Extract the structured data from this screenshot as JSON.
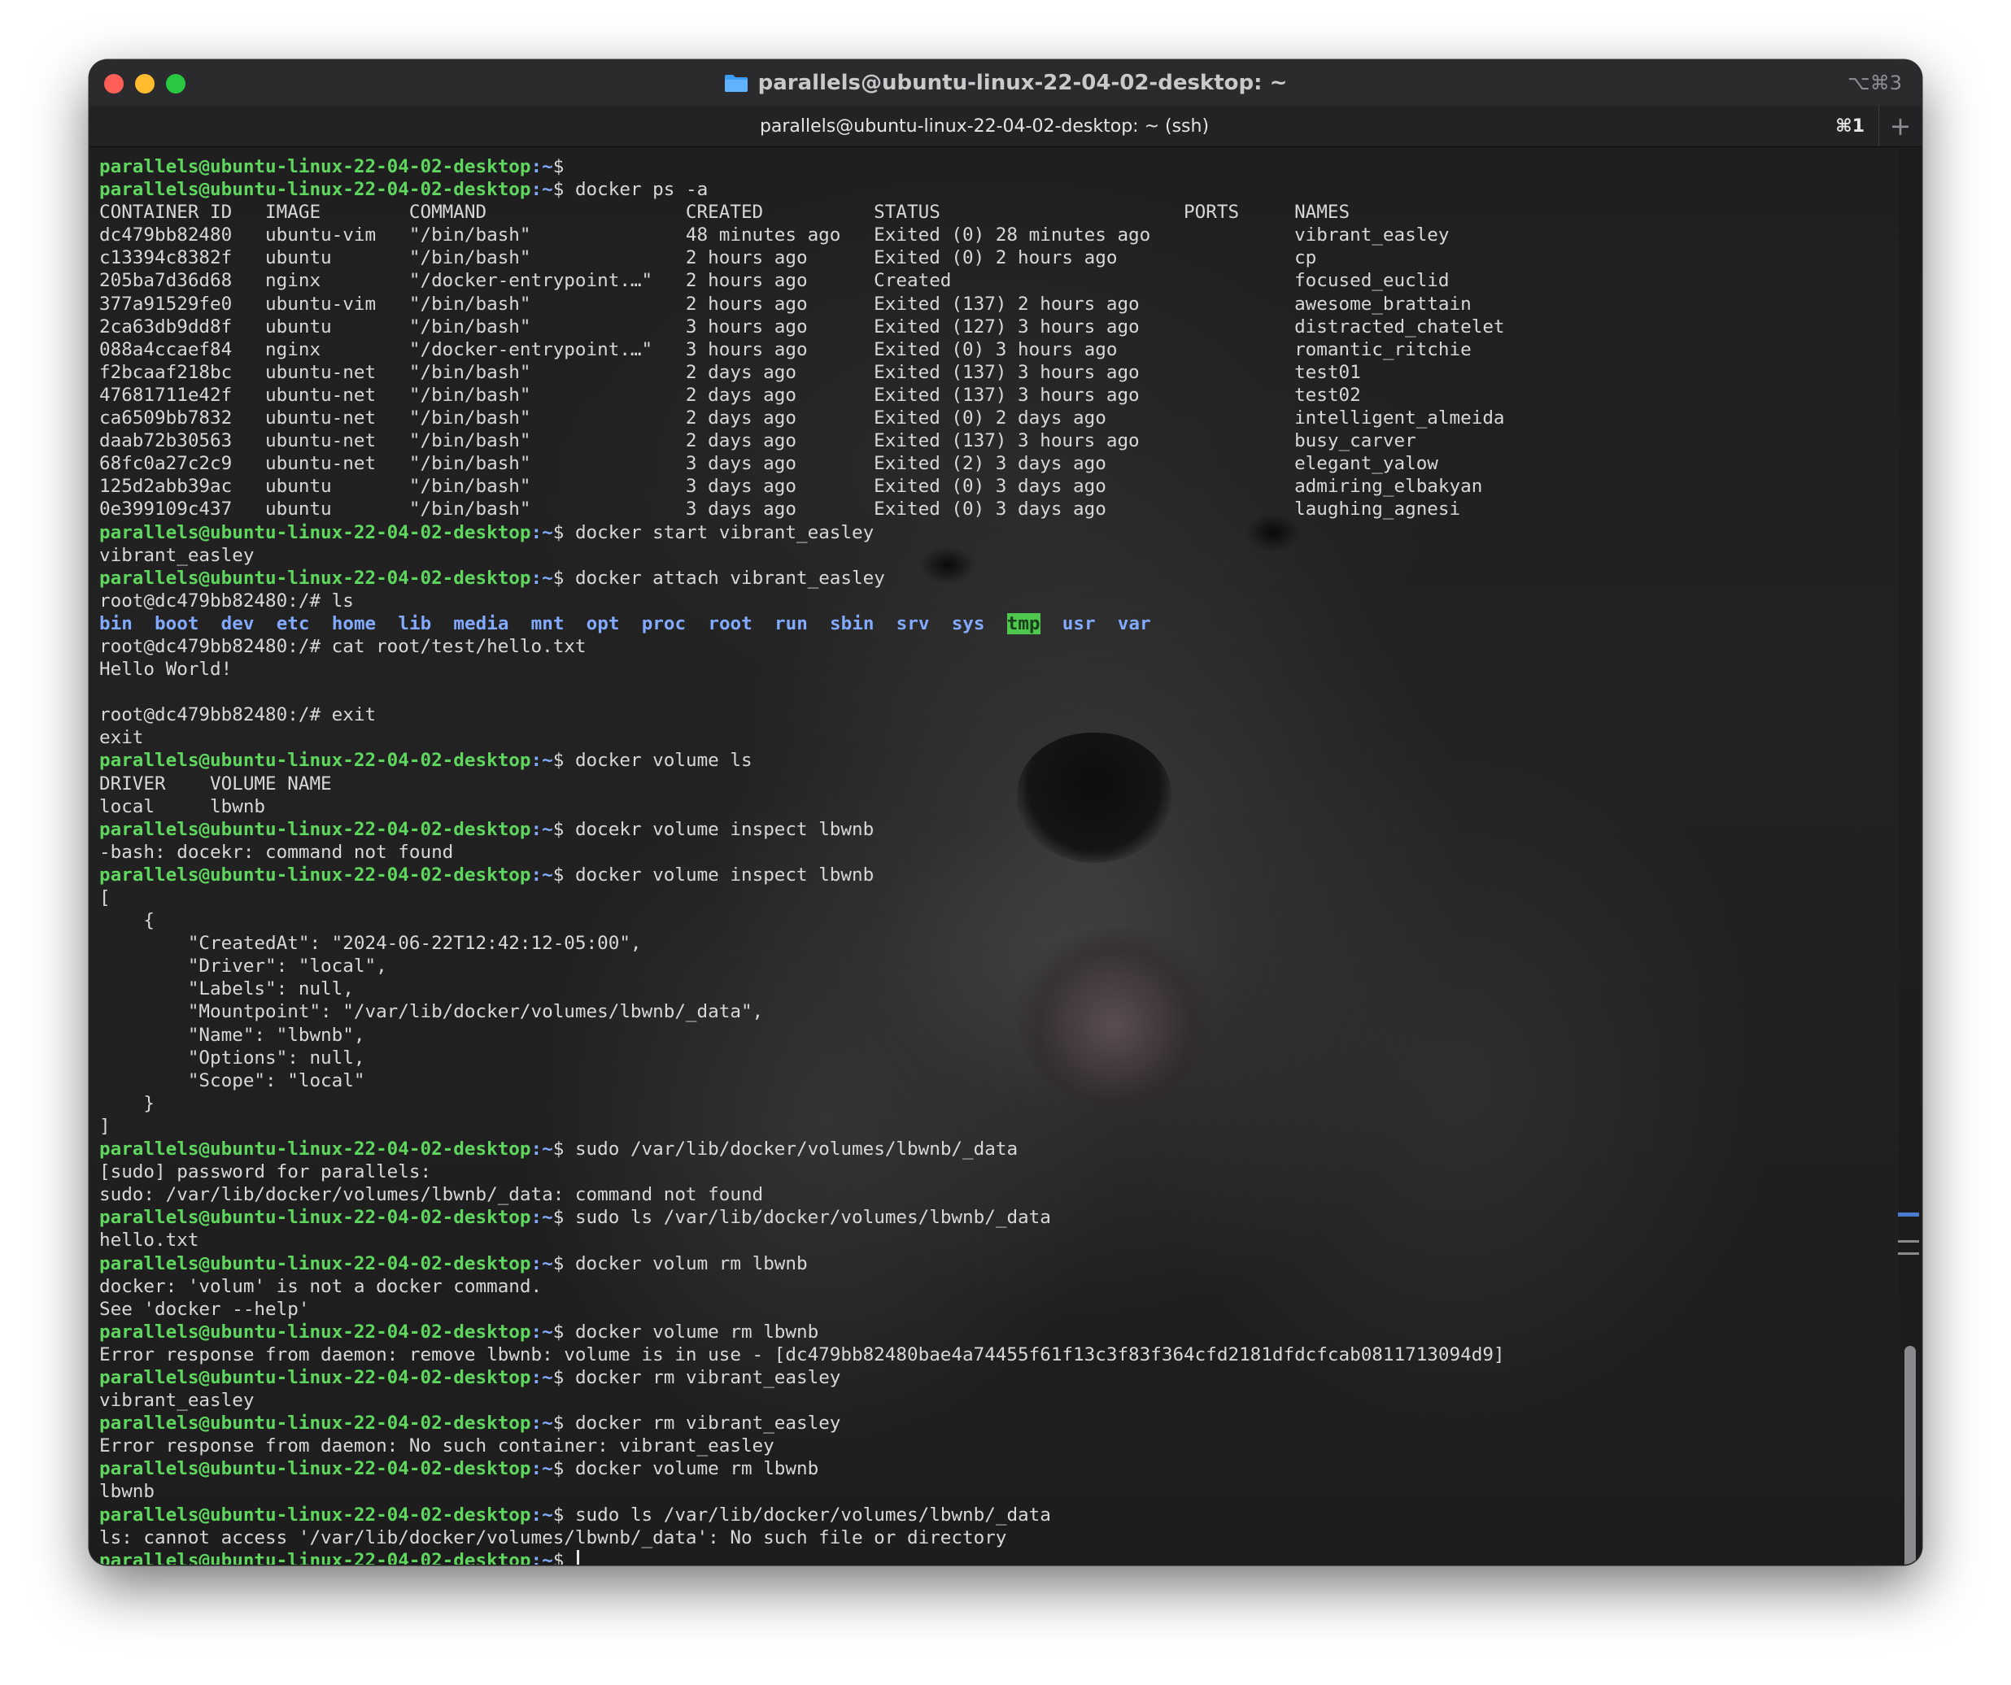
{
  "window": {
    "title": "parallels@ubuntu-linux-22-04-02-desktop: ~",
    "shortcut": "⌥⌘3",
    "tab_label": "parallels@ubuntu-linux-22-04-02-desktop: ~ (ssh)",
    "tab_shortcut": "⌘1",
    "new_tab_symbol": "+"
  },
  "colors": {
    "prompt_user": "#5fd75f",
    "prompt_path": "#82aaff",
    "directory": "#82aaff",
    "tmp_background": "#4ec94e",
    "text": "#d8d8d8"
  },
  "prompt": {
    "user_host": "parallels@ubuntu-linux-22-04-02-desktop",
    "path": ":~",
    "symbol": "$"
  },
  "terminal": {
    "lines": [
      {
        "type": "prompt",
        "cmd": ""
      },
      {
        "type": "prompt",
        "cmd": "docker ps -a"
      },
      {
        "type": "out",
        "text": "CONTAINER ID   IMAGE        COMMAND                  CREATED          STATUS                      PORTS     NAMES"
      },
      {
        "type": "out",
        "text": "dc479bb82480   ubuntu-vim   \"/bin/bash\"              48 minutes ago   Exited (0) 28 minutes ago             vibrant_easley"
      },
      {
        "type": "out",
        "text": "c13394c8382f   ubuntu       \"/bin/bash\"              2 hours ago      Exited (0) 2 hours ago                cp"
      },
      {
        "type": "out",
        "text": "205ba7d36d68   nginx        \"/docker-entrypoint.…\"   2 hours ago      Created                               focused_euclid"
      },
      {
        "type": "out",
        "text": "377a91529fe0   ubuntu-vim   \"/bin/bash\"              2 hours ago      Exited (137) 2 hours ago              awesome_brattain"
      },
      {
        "type": "out",
        "text": "2ca63db9dd8f   ubuntu       \"/bin/bash\"              3 hours ago      Exited (127) 3 hours ago              distracted_chatelet"
      },
      {
        "type": "out",
        "text": "088a4ccaef84   nginx        \"/docker-entrypoint.…\"   3 hours ago      Exited (0) 3 hours ago                romantic_ritchie"
      },
      {
        "type": "out",
        "text": "f2bcaaf218bc   ubuntu-net   \"/bin/bash\"              2 days ago       Exited (137) 3 hours ago              test01"
      },
      {
        "type": "out",
        "text": "47681711e42f   ubuntu-net   \"/bin/bash\"              2 days ago       Exited (137) 3 hours ago              test02"
      },
      {
        "type": "out",
        "text": "ca6509bb7832   ubuntu-net   \"/bin/bash\"              2 days ago       Exited (0) 2 days ago                 intelligent_almeida"
      },
      {
        "type": "out",
        "text": "daab72b30563   ubuntu-net   \"/bin/bash\"              2 days ago       Exited (137) 3 hours ago              busy_carver"
      },
      {
        "type": "out",
        "text": "68fc0a27c2c9   ubuntu-net   \"/bin/bash\"              3 days ago       Exited (2) 3 days ago                 elegant_yalow"
      },
      {
        "type": "out",
        "text": "125d2abb39ac   ubuntu       \"/bin/bash\"              3 days ago       Exited (0) 3 days ago                 admiring_elbakyan"
      },
      {
        "type": "out",
        "text": "0e399109c437   ubuntu       \"/bin/bash\"              3 days ago       Exited (0) 3 days ago                 laughing_agnesi"
      },
      {
        "type": "prompt",
        "cmd": "docker start vibrant_easley"
      },
      {
        "type": "out",
        "text": "vibrant_easley"
      },
      {
        "type": "prompt",
        "cmd": "docker attach vibrant_easley"
      },
      {
        "type": "out",
        "text": "root@dc479bb82480:/# ls"
      },
      {
        "type": "ls",
        "items": [
          "bin",
          "boot",
          "dev",
          "etc",
          "home",
          "lib",
          "media",
          "mnt",
          "opt",
          "proc",
          "root",
          "run",
          "sbin",
          "srv",
          "sys",
          "tmp",
          "usr",
          "var"
        ]
      },
      {
        "type": "out",
        "text": "root@dc479bb82480:/# cat root/test/hello.txt"
      },
      {
        "type": "out",
        "text": "Hello World!"
      },
      {
        "type": "out",
        "text": ""
      },
      {
        "type": "out",
        "text": "root@dc479bb82480:/# exit"
      },
      {
        "type": "out",
        "text": "exit"
      },
      {
        "type": "prompt",
        "cmd": "docker volume ls"
      },
      {
        "type": "out",
        "text": "DRIVER    VOLUME NAME"
      },
      {
        "type": "out",
        "text": "local     lbwnb"
      },
      {
        "type": "prompt",
        "cmd": "docekr volume inspect lbwnb"
      },
      {
        "type": "out",
        "text": "-bash: docekr: command not found"
      },
      {
        "type": "prompt",
        "cmd": "docker volume inspect lbwnb"
      },
      {
        "type": "out",
        "text": "["
      },
      {
        "type": "out",
        "text": "    {"
      },
      {
        "type": "out",
        "text": "        \"CreatedAt\": \"2024-06-22T12:42:12-05:00\","
      },
      {
        "type": "out",
        "text": "        \"Driver\": \"local\","
      },
      {
        "type": "out",
        "text": "        \"Labels\": null,"
      },
      {
        "type": "out",
        "text": "        \"Mountpoint\": \"/var/lib/docker/volumes/lbwnb/_data\","
      },
      {
        "type": "out",
        "text": "        \"Name\": \"lbwnb\","
      },
      {
        "type": "out",
        "text": "        \"Options\": null,"
      },
      {
        "type": "out",
        "text": "        \"Scope\": \"local\""
      },
      {
        "type": "out",
        "text": "    }"
      },
      {
        "type": "out",
        "text": "]"
      },
      {
        "type": "prompt",
        "cmd": "sudo /var/lib/docker/volumes/lbwnb/_data"
      },
      {
        "type": "out",
        "text": "[sudo] password for parallels:"
      },
      {
        "type": "out",
        "text": "sudo: /var/lib/docker/volumes/lbwnb/_data: command not found"
      },
      {
        "type": "prompt",
        "cmd": "sudo ls /var/lib/docker/volumes/lbwnb/_data"
      },
      {
        "type": "out",
        "text": "hello.txt"
      },
      {
        "type": "prompt",
        "cmd": "docker volum rm lbwnb"
      },
      {
        "type": "out",
        "text": "docker: 'volum' is not a docker command."
      },
      {
        "type": "out",
        "text": "See 'docker --help'"
      },
      {
        "type": "prompt",
        "cmd": "docker volume rm lbwnb"
      },
      {
        "type": "out",
        "text": "Error response from daemon: remove lbwnb: volume is in use - [dc479bb82480bae4a74455f61f13c3f83f364cfd2181dfdcfcab0811713094d9]"
      },
      {
        "type": "prompt",
        "cmd": "docker rm vibrant_easley"
      },
      {
        "type": "out",
        "text": "vibrant_easley"
      },
      {
        "type": "prompt",
        "cmd": "docker rm vibrant_easley"
      },
      {
        "type": "out",
        "text": "Error response from daemon: No such container: vibrant_easley"
      },
      {
        "type": "prompt",
        "cmd": "docker volume rm lbwnb"
      },
      {
        "type": "out",
        "text": "lbwnb"
      },
      {
        "type": "prompt",
        "cmd": "sudo ls /var/lib/docker/volumes/lbwnb/_data"
      },
      {
        "type": "out",
        "text": "ls: cannot access '/var/lib/docker/volumes/lbwnb/_data': No such file or directory"
      },
      {
        "type": "prompt",
        "cmd": "",
        "cursor": true
      }
    ]
  }
}
